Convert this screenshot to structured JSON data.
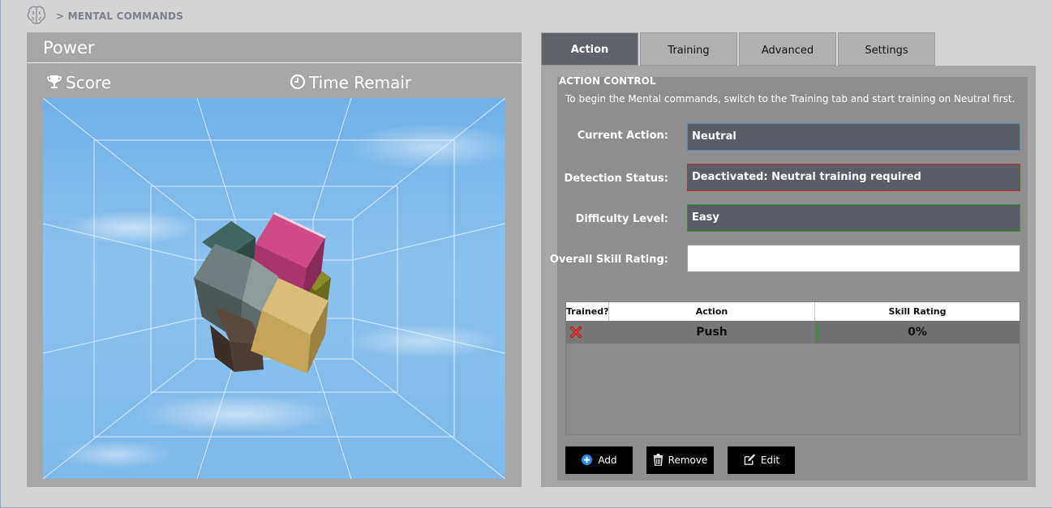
{
  "breadcrumb": {
    "icon": "brain-icon",
    "text": "> MENTAL COMMANDS"
  },
  "left_panel": {
    "title": "Power",
    "score_label": "Score",
    "time_label": "Time Remaining",
    "icons": {
      "score": "trophy-icon",
      "time": "clock-icon"
    }
  },
  "tabs": [
    {
      "label": "Action",
      "active": true
    },
    {
      "label": "Training",
      "active": false
    },
    {
      "label": "Advanced",
      "active": false
    },
    {
      "label": "Settings",
      "active": false
    }
  ],
  "action_control": {
    "title": "ACTION CONTROL",
    "description": "To begin the Mental commands, switch to the Training tab and start training on Neutral first.",
    "fields": {
      "current_action": {
        "label": "Current Action:",
        "value": "Neutral",
        "color": "#4d86c9"
      },
      "detection_status": {
        "label": "Detection Status:",
        "value": "Deactivated: Neutral training required",
        "color": "#c82a2a"
      },
      "difficulty_level": {
        "label": "Difficulty Level:",
        "value": "Easy",
        "color": "#2e9a2e"
      },
      "overall_skill": {
        "label": "Overall Skill Rating:",
        "value": ""
      }
    },
    "table": {
      "columns": [
        "Trained?",
        "Action",
        "Skill Rating"
      ],
      "rows": [
        {
          "trained_icon": "red-x-icon",
          "action": "Push",
          "skill": "0%",
          "skill_fraction": 0
        }
      ]
    },
    "buttons": {
      "add": {
        "label": "Add",
        "icon": "plus-circle-icon"
      },
      "remove": {
        "label": "Remove",
        "icon": "trash-icon"
      },
      "edit": {
        "label": "Edit",
        "icon": "edit-icon"
      }
    }
  }
}
